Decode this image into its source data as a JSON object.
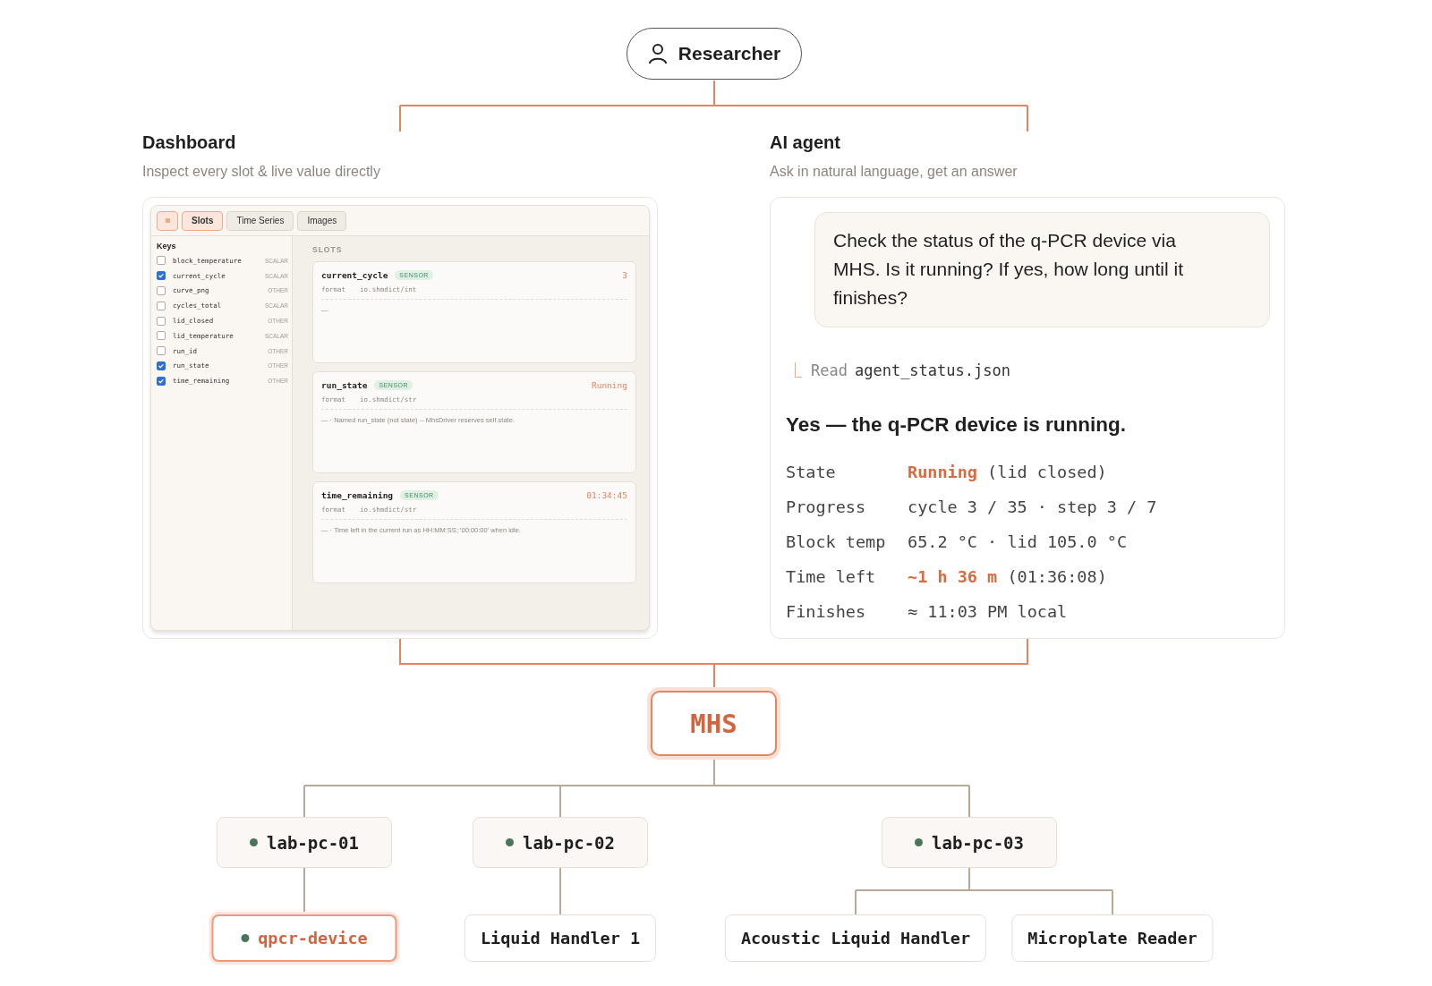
{
  "user": {
    "label": "Researcher"
  },
  "dashboard": {
    "title": "Dashboard",
    "subtitle": "Inspect every slot & live value directly",
    "app": {
      "tabs": [
        {
          "label": "Slots",
          "selected": true
        },
        {
          "label": "Time Series",
          "selected": false
        },
        {
          "label": "Images",
          "selected": false
        }
      ],
      "keys_heading": "Keys",
      "keys": [
        {
          "name": "block_temperature",
          "type": "SCALAR",
          "checked": false
        },
        {
          "name": "current_cycle",
          "type": "SCALAR",
          "checked": true
        },
        {
          "name": "curve_png",
          "type": "OTHER",
          "checked": false
        },
        {
          "name": "cycles_total",
          "type": "SCALAR",
          "checked": false
        },
        {
          "name": "lid_closed",
          "type": "OTHER",
          "checked": false
        },
        {
          "name": "lid_temperature",
          "type": "SCALAR",
          "checked": false
        },
        {
          "name": "run_id",
          "type": "OTHER",
          "checked": false
        },
        {
          "name": "run_state",
          "type": "OTHER",
          "checked": true
        },
        {
          "name": "time_remaining",
          "type": "OTHER",
          "checked": true
        }
      ],
      "slots_heading": "SLOTS",
      "slots": [
        {
          "name": "current_cycle",
          "badge": "SENSOR",
          "format_label": "format",
          "format": "io.shmdict/int",
          "value": "3",
          "description": "—"
        },
        {
          "name": "run_state",
          "badge": "SENSOR",
          "format_label": "format",
          "format": "io.shmdict/str",
          "value": "Running",
          "description": "— · Named run_state (not state) -- MhsDriver reserves self.state."
        },
        {
          "name": "time_remaining",
          "badge": "SENSOR",
          "format_label": "format",
          "format": "io.shmdict/str",
          "value": "01:34:45",
          "description": "— · Time left in the current run as HH:MM:SS; '00:00:00' when idle."
        }
      ]
    }
  },
  "agent": {
    "title": "AI agent",
    "subtitle": "Ask in natural language, get an answer",
    "prompt": "Check the status of the q-PCR device via MHS. Is it running? If yes, how long until it finishes?",
    "tool": {
      "verb": "Read",
      "file": "agent_status.json"
    },
    "answer": "Yes — the q-PCR device is running.",
    "facts": [
      {
        "label": "State",
        "segments": [
          {
            "text": "Running",
            "accent": true
          },
          {
            "text": " (lid closed)",
            "accent": false
          }
        ]
      },
      {
        "label": "Progress",
        "segments": [
          {
            "text": "cycle 3 / 35 · step 3 / 7",
            "accent": false
          }
        ]
      },
      {
        "label": "Block temp",
        "segments": [
          {
            "text": "65.2 °C · lid 105.0 °C",
            "accent": false
          }
        ]
      },
      {
        "label": "Time left",
        "segments": [
          {
            "text": "~1 h 36 m",
            "accent": true
          },
          {
            "text": " (01:36:08)",
            "accent": false
          }
        ]
      },
      {
        "label": "Finishes",
        "segments": [
          {
            "text": "≈ 11:03 PM local",
            "accent": false
          }
        ]
      }
    ]
  },
  "hub": {
    "label": "MHS"
  },
  "hosts": [
    {
      "name": "lab-pc-01",
      "devices": [
        {
          "name": "qpcr-device",
          "selected": true
        }
      ]
    },
    {
      "name": "lab-pc-02",
      "devices": [
        {
          "name": "Liquid Handler 1",
          "selected": false
        }
      ]
    },
    {
      "name": "lab-pc-03",
      "devices": [
        {
          "name": "Acoustic Liquid Handler",
          "selected": false
        },
        {
          "name": "Microplate Reader",
          "selected": false
        }
      ]
    }
  ]
}
